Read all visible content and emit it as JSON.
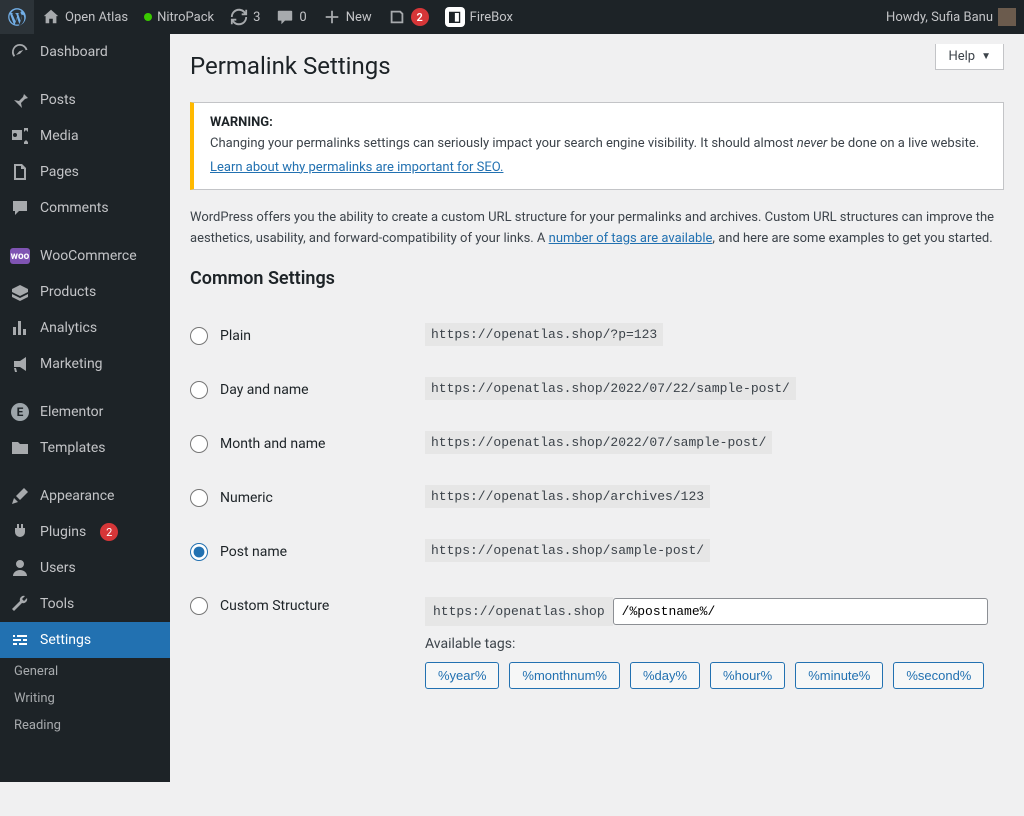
{
  "adminbar": {
    "site_name": "Open Atlas",
    "nitropack": "NitroPack",
    "update_count": "3",
    "comments_count": "0",
    "new_label": "New",
    "yoast_count": "2",
    "firebox": "FireBox",
    "howdy": "Howdy, Sufia Banu"
  },
  "menu": {
    "dashboard": "Dashboard",
    "posts": "Posts",
    "media": "Media",
    "pages": "Pages",
    "comments": "Comments",
    "woocommerce": "WooCommerce",
    "products": "Products",
    "analytics": "Analytics",
    "marketing": "Marketing",
    "elementor": "Elementor",
    "templates": "Templates",
    "appearance": "Appearance",
    "plugins": "Plugins",
    "plugins_count": "2",
    "users": "Users",
    "tools": "Tools",
    "settings": "Settings",
    "sub_general": "General",
    "sub_writing": "Writing",
    "sub_reading": "Reading"
  },
  "content": {
    "help": "Help",
    "title": "Permalink Settings",
    "warning_heading": "WARNING:",
    "warning_line1a": "Changing your permalinks settings can seriously impact your search engine visibility. It should almost ",
    "warning_never": "never",
    "warning_line1b": " be done on a live website.",
    "warning_link": "Learn about why permalinks are important for SEO.",
    "intro_1": "WordPress offers you the ability to create a custom URL structure for your permalinks and archives. Custom URL structures can improve the aesthetics, usability, and forward-compatibility of your links. A ",
    "intro_link": "number of tags are available",
    "intro_2": ", and here are some examples to get you started.",
    "h2": "Common Settings",
    "opts": [
      {
        "label": "Plain",
        "example": "https://openatlas.shop/?p=123",
        "checked": false
      },
      {
        "label": "Day and name",
        "example": "https://openatlas.shop/2022/07/22/sample-post/",
        "checked": false
      },
      {
        "label": "Month and name",
        "example": "https://openatlas.shop/2022/07/sample-post/",
        "checked": false
      },
      {
        "label": "Numeric",
        "example": "https://openatlas.shop/archives/123",
        "checked": false
      },
      {
        "label": "Post name",
        "example": "https://openatlas.shop/sample-post/",
        "checked": true
      }
    ],
    "custom_label": "Custom Structure",
    "custom_prefix": "https://openatlas.shop",
    "custom_value": "/%postname%/",
    "available_tags_label": "Available tags:",
    "tags": [
      "%year%",
      "%monthnum%",
      "%day%",
      "%hour%",
      "%minute%",
      "%second%"
    ]
  }
}
